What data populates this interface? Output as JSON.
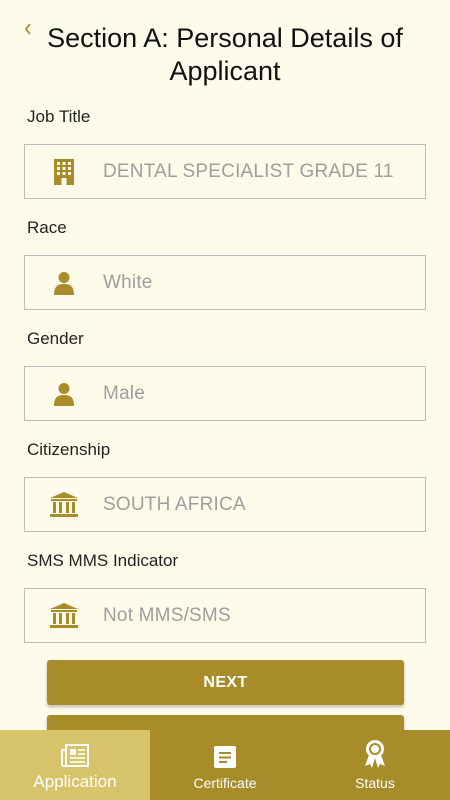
{
  "header": {
    "title": "Section A: Personal Details of Applicant",
    "back_icon": "chevron-left-icon"
  },
  "fields": [
    {
      "label": "Job Title",
      "value": "DENTAL SPECIALIST GRADE 11",
      "icon": "building-icon"
    },
    {
      "label": "Race",
      "value": "White",
      "icon": "person-icon"
    },
    {
      "label": "Gender",
      "value": "Male",
      "icon": "person-icon"
    },
    {
      "label": "Citizenship",
      "value": "SOUTH AFRICA",
      "icon": "bank-icon"
    },
    {
      "label": "SMS MMS Indicator",
      "value": "Not MMS/SMS",
      "icon": "bank-icon"
    }
  ],
  "buttons": {
    "next_label": "NEXT"
  },
  "bottom_nav": {
    "items": [
      {
        "label": "Application",
        "icon": "newspaper-icon",
        "active": true
      },
      {
        "label": "Certificate",
        "icon": "document-icon",
        "active": false
      },
      {
        "label": "Status",
        "icon": "award-icon",
        "active": false
      }
    ]
  },
  "colors": {
    "accent": "#a88c2a",
    "accent_light": "#d7c36a",
    "background": "#fdfbea"
  }
}
